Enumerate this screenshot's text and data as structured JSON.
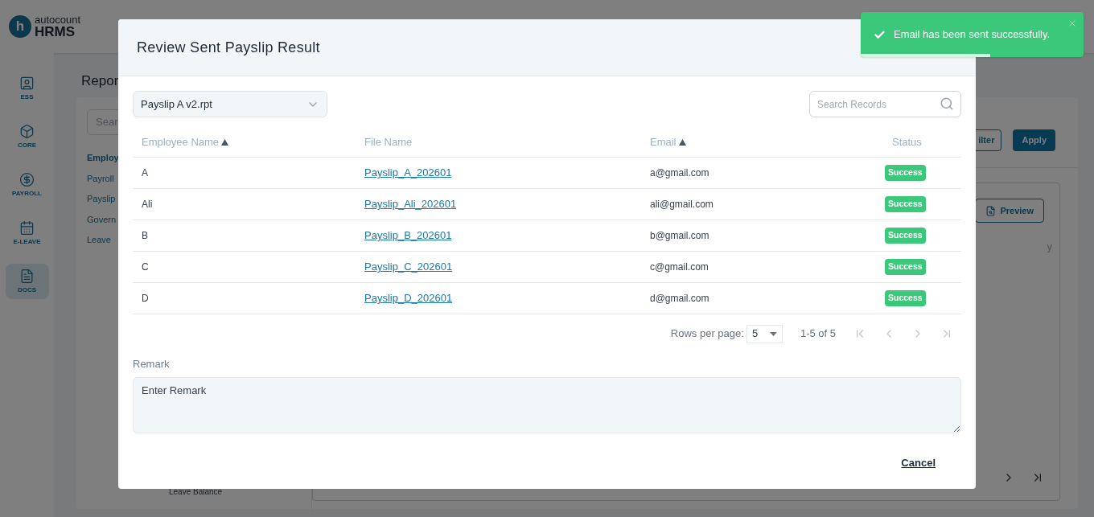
{
  "app": {
    "logo_mark": "h",
    "logo_top": "autocount",
    "logo_bottom": "HRMS"
  },
  "sidebar": [
    {
      "label": "ESS",
      "selected": false
    },
    {
      "label": "CORE",
      "selected": false
    },
    {
      "label": "PAYROLL",
      "selected": false
    },
    {
      "label": "E-LEAVE",
      "selected": false
    },
    {
      "label": "DOCS",
      "selected": true
    }
  ],
  "page": {
    "title": "Repor",
    "search_placeholder": "Sear",
    "categories": [
      {
        "label": "Employ",
        "selected": true
      },
      {
        "label": "Payroll",
        "selected": false
      },
      {
        "label": "Payslip",
        "selected": false
      },
      {
        "label": "Govern",
        "selected": false
      },
      {
        "label": "Leave",
        "selected": false
      }
    ],
    "sub_item": "Leave Balance",
    "filter_button": "ilter",
    "apply_button": "Apply",
    "preview_button": "Preview",
    "column_text": "y"
  },
  "dialog": {
    "title": "Review Sent Payslip Result",
    "template": "Payslip A v2.rpt",
    "search_placeholder": "Search Records",
    "columns": [
      {
        "label": "Employee Name",
        "sorted": true
      },
      {
        "label": "File Name",
        "sorted": false
      },
      {
        "label": "Email",
        "sorted": true
      },
      {
        "label": "Status",
        "sorted": false
      }
    ],
    "rows": [
      {
        "name": "A",
        "file": "Payslip_A_202601",
        "email": "a@gmail.com",
        "status": "Success",
        "kind": "success"
      },
      {
        "name": "Ali",
        "file": "Payslip_Ali_202601",
        "email": "ali@gmail.com",
        "status": "Success",
        "kind": "success"
      },
      {
        "name": "B",
        "file": "Payslip_B_202601",
        "email": "b@gmail.com",
        "status": "Success",
        "kind": "success"
      },
      {
        "name": "C",
        "file": "Payslip_C_202601",
        "email": "c@gmail.com",
        "status": "Success",
        "kind": "success"
      },
      {
        "name": "D",
        "file": "Payslip_D_202601",
        "email": "d@gmail.com",
        "status": "Success",
        "kind": "success"
      }
    ],
    "rows_per_page_label": "Rows per page:",
    "rows_per_page": "5",
    "range": "1-5 of 5",
    "remark_label": "Remark",
    "remark_placeholder": "Enter Remark",
    "cancel_button": "Cancel"
  },
  "toast": {
    "message": "Email has been sent successfully.",
    "level": 0.58
  }
}
